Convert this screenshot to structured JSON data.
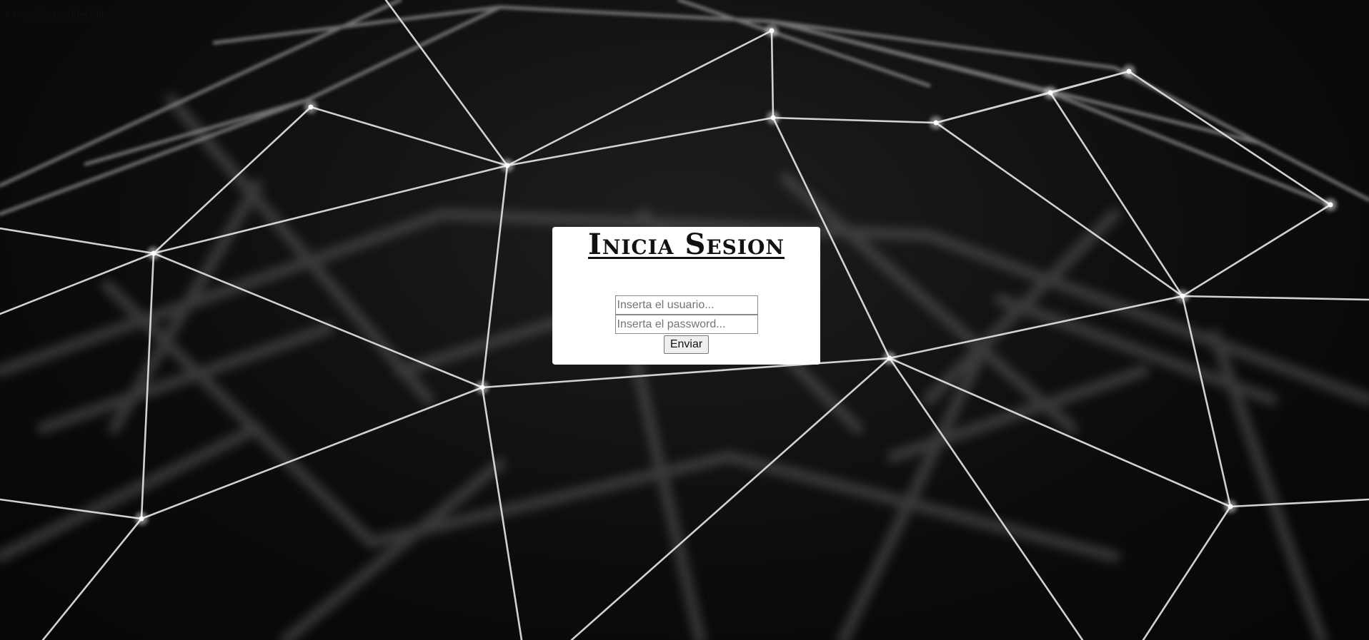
{
  "status": {
    "text": "Conexión establecida"
  },
  "login": {
    "title": "Inicia Sesion",
    "username_placeholder": "Inserta el usuario...",
    "password_placeholder": "Inserta el password...",
    "submit_label": "Enviar"
  },
  "colors": {
    "background": "#0a0a0a",
    "panel": "#ffffff",
    "mesh_lines": "#d8d8d8"
  },
  "icons": {
    "background_image": "network-mesh-background"
  }
}
